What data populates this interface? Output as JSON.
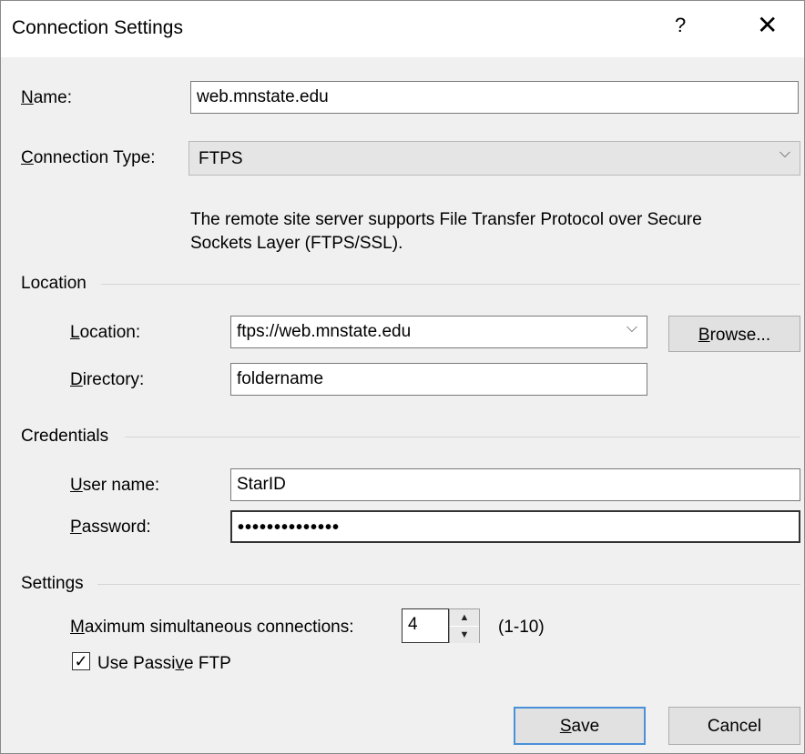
{
  "window": {
    "title": "Connection Settings",
    "help_glyph": "?",
    "close_glyph": "✕"
  },
  "name": {
    "label_u": "N",
    "label_rest": "ame:",
    "value": "web.mnstate.edu"
  },
  "connection_type": {
    "label_u": "C",
    "label_rest": "onnection Type:",
    "value": "FTPS",
    "description_line1": "The remote site server supports File Transfer Protocol over Secure",
    "description_line2": "Sockets Layer (FTPS/SSL)."
  },
  "location_group": {
    "title": "Location",
    "location_label_u": "L",
    "location_label_rest": "ocation:",
    "location_value": "ftps://web.mnstate.edu",
    "browse_label_u": "B",
    "browse_label_rest": "rowse...",
    "directory_label_u": "D",
    "directory_label_rest": "irectory:",
    "directory_value": "foldername"
  },
  "credentials_group": {
    "title": "Credentials",
    "user_label_u": "U",
    "user_label_rest": "ser name:",
    "user_value": "StarID",
    "password_label_u": "P",
    "password_label_rest": "assword:",
    "password_mask": "••••••••••••••"
  },
  "settings_group": {
    "title": "Settings",
    "max_label_u": "M",
    "max_label_rest": "aximum simultaneous connections:",
    "max_value": "4",
    "range_hint": "(1-10)",
    "passive_label_pre": "Use Passi",
    "passive_label_u": "v",
    "passive_label_post": "e FTP",
    "passive_checked_glyph": "✓",
    "spin_up": "▲",
    "spin_down": "▼"
  },
  "buttons": {
    "save_u": "S",
    "save_rest": "ave",
    "cancel": "Cancel"
  },
  "icons": {
    "chevron": "⌵"
  }
}
